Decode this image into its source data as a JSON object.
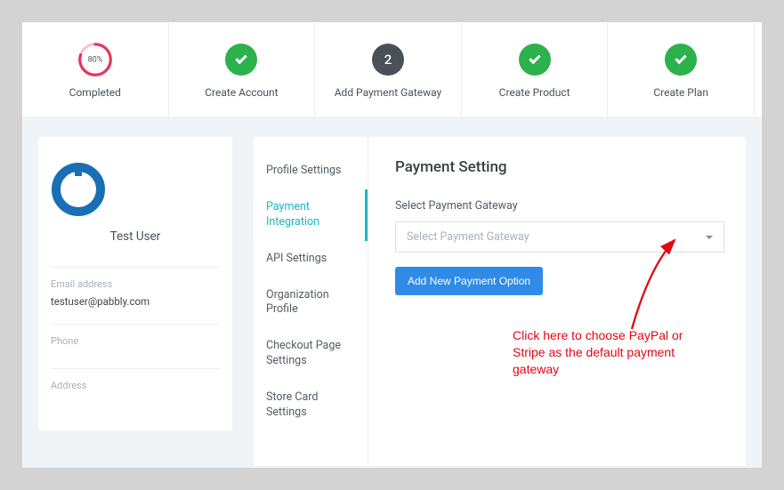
{
  "progress": {
    "percent_text": "80%",
    "percent_value": 80,
    "label": "Completed"
  },
  "steps": [
    {
      "label": "Create Account",
      "state": "done"
    },
    {
      "label": "Add Payment Gateway",
      "state": "current",
      "num": "2"
    },
    {
      "label": "Create Product",
      "state": "done"
    },
    {
      "label": "Create Plan",
      "state": "done"
    }
  ],
  "profile": {
    "name": "Test User",
    "fields": [
      {
        "label": "Email address",
        "value": "testuser@pabbly.com"
      },
      {
        "label": "Phone",
        "value": ""
      },
      {
        "label": "Address",
        "value": ""
      }
    ]
  },
  "tabs": [
    "Profile Settings",
    "Payment Integration",
    "API Settings",
    "Organization Profile",
    "Checkout Page Settings",
    "Store Card Settings"
  ],
  "active_tab_index": 1,
  "panel": {
    "title": "Payment Setting",
    "select_label": "Select Payment Gateway",
    "select_placeholder": "Select Payment Gateway",
    "add_button": "Add New Payment Option"
  },
  "annotation": "Click here to choose PayPal or Stripe as the default payment gateway"
}
